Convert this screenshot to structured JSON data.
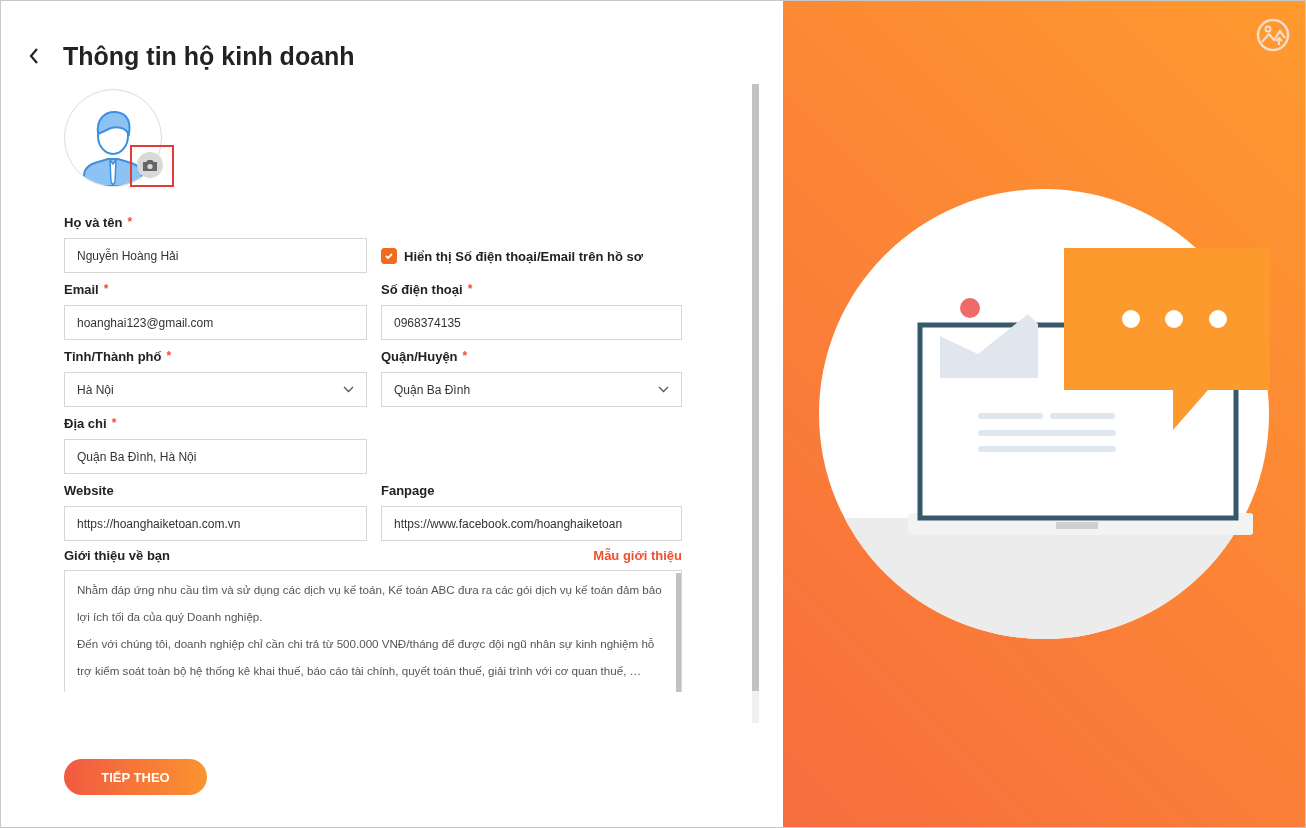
{
  "header": {
    "title": "Thông tin hộ kinh doanh"
  },
  "avatar": {
    "highlighted": true
  },
  "rows": [
    [
      {
        "kind": "text",
        "label": "Họ và tên",
        "mark": "*",
        "value": "Nguyễn Hoàng Hải"
      },
      {
        "kind": "checkbox",
        "label": "Hiển thị Số điện thoại/Email trên hồ sơ",
        "checked": true
      }
    ],
    [
      {
        "kind": "text",
        "label": "Email",
        "mark": "*",
        "value": "hoanghai123@gmail.com"
      },
      {
        "kind": "text",
        "label": "Số điện thoại",
        "mark": "*",
        "value": "0968374135"
      }
    ],
    [
      {
        "kind": "select",
        "label": "Tỉnh/Thành phố",
        "mark": "*",
        "value": "Hà Nội"
      },
      {
        "kind": "select",
        "label": "Quận/Huyện",
        "mark": "*",
        "value": "Quận Ba Đình"
      }
    ],
    [
      {
        "kind": "text",
        "label": "Địa chỉ",
        "mark": "*",
        "value": "Quận Ba Đình, Hà Nội"
      }
    ],
    [
      {
        "kind": "text",
        "label": "Website",
        "value": "https://hoanghaiketoan.com.vn"
      },
      {
        "kind": "text",
        "label": "Fanpage",
        "value": "https://www.facebook.com/hoanghaiketoan"
      }
    ]
  ],
  "intro": {
    "label": "Giới thiệu về bạn",
    "link": "Mẫu giới thiệu",
    "paragraphs": [
      "Nhằm đáp ứng nhu cầu tìm và sử dụng các dịch vụ kế toán, Kế toán ABC đưa ra các gói dịch vụ kế toán đảm bảo lợi ích tối đa của quý Doanh nghiệp.",
      "Đến với chúng tôi, doanh nghiệp chỉ cần chi trả từ 500.000 VNĐ/tháng để được đội ngũ nhân sự kinh nghiệm hỗ trợ kiểm soát toàn bộ hệ thống kê khai thuế, báo cáo tài chính, quyết toán thuế, giải trình với cơ quan thuế, …"
    ]
  },
  "next_button": "TIẾP THEO"
}
